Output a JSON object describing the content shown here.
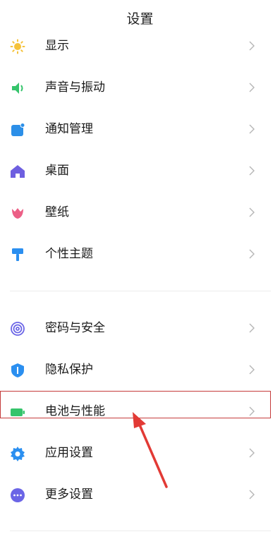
{
  "header": {
    "title": "设置"
  },
  "groups": [
    {
      "items": [
        {
          "label": "显示",
          "icon": "sun-icon",
          "color": "#f5c23a"
        },
        {
          "label": "声音与振动",
          "icon": "speaker-icon",
          "color": "#35c46b"
        },
        {
          "label": "通知管理",
          "icon": "notification-icon",
          "color": "#2c8fe8"
        },
        {
          "label": "桌面",
          "icon": "home-icon",
          "color": "#6e5fe0"
        },
        {
          "label": "壁纸",
          "icon": "tulip-icon",
          "color": "#ec5f86"
        },
        {
          "label": "个性主题",
          "icon": "paint-roller-icon",
          "color": "#2b8ff0"
        }
      ]
    },
    {
      "items": [
        {
          "label": "密码与安全",
          "icon": "fingerprint-icon",
          "color": "#6b65e6"
        },
        {
          "label": "隐私保护",
          "icon": "shield-icon",
          "color": "#2b8ff0"
        },
        {
          "label": "电池与性能",
          "icon": "battery-icon",
          "color": "#35c46b"
        },
        {
          "label": "应用设置",
          "icon": "gear-icon",
          "color": "#2b8ff0"
        },
        {
          "label": "更多设置",
          "icon": "more-icon",
          "color": "#6b65e6"
        }
      ]
    }
  ],
  "annotation": {
    "highlight_color": "#c53b3b",
    "arrow_color": "#e23a35"
  }
}
